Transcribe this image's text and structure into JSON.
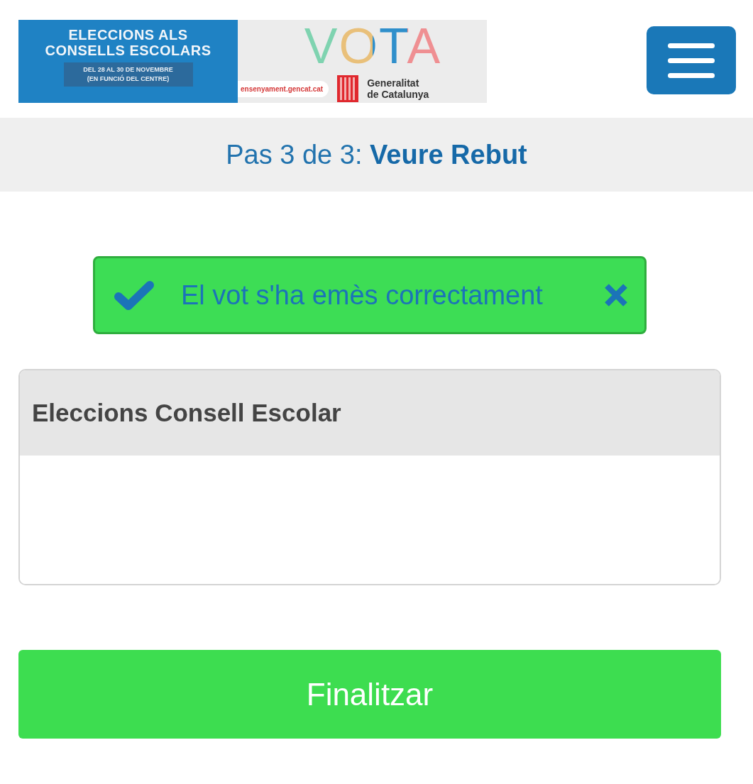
{
  "header": {
    "banner": {
      "title_lines": [
        "ELECCIONS ALS",
        "CONSELLS ESCOLARS"
      ],
      "date_lines": [
        "DEL 28 AL 30 DE NOVEMBRE",
        "(EN FUNCIÓ DEL CENTRE)"
      ],
      "wordmark": "VOTA",
      "website": "ensenyament.gencat.cat",
      "institution_lines": [
        "Generalitat",
        "de Catalunya"
      ]
    }
  },
  "step_bar": {
    "text": "Pas 3 de 3: **Veure Rebut**"
  },
  "alert": {
    "kind": "success",
    "message": "El vot s'ha emès correctament",
    "dismissible": true
  },
  "panel": {
    "title": "Eleccions Consell Escolar"
  },
  "finish_button": {
    "kind": "success",
    "label": "Finalitzar"
  }
}
